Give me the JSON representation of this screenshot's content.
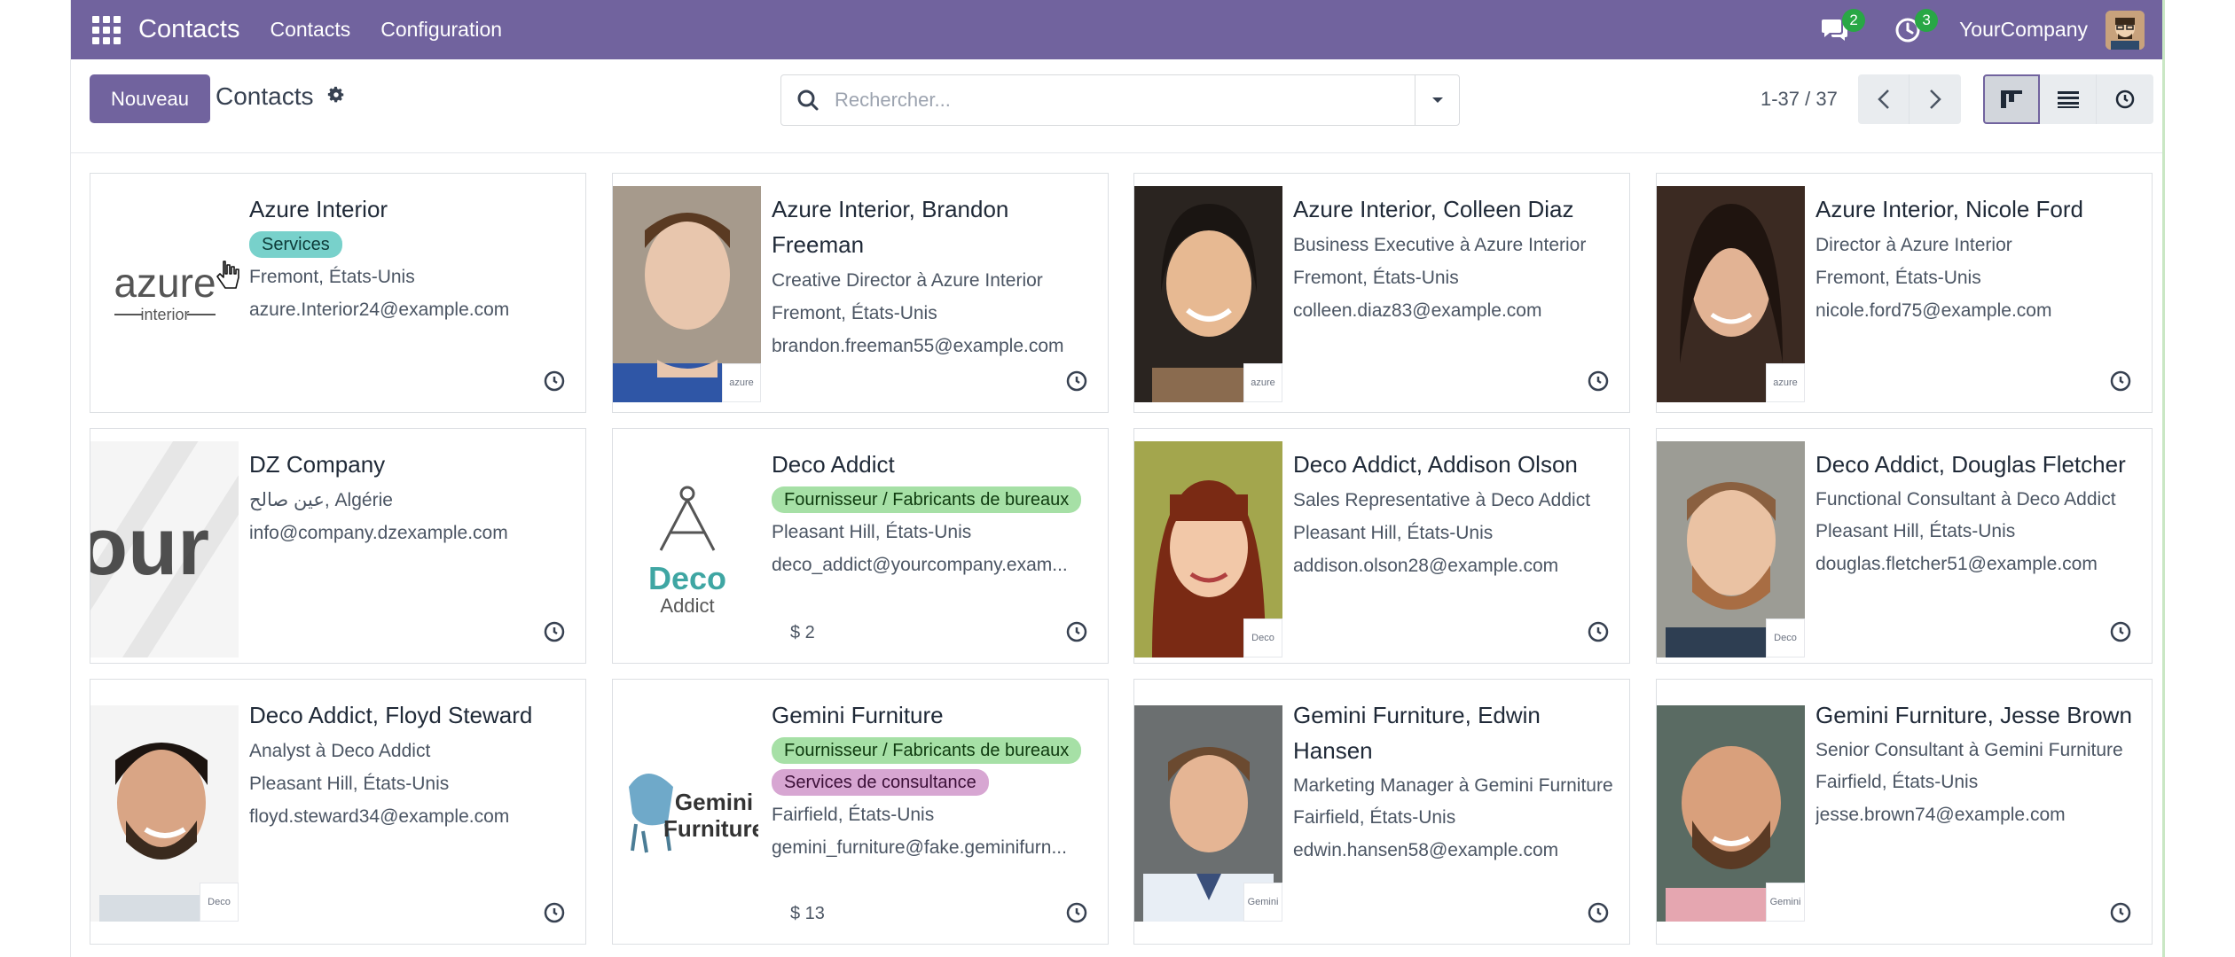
{
  "navbar": {
    "brand": "Contacts",
    "menus": [
      "Contacts",
      "Configuration"
    ],
    "messages_count": "2",
    "activities_count": "3",
    "company": "YourCompany",
    "color": "#71639e"
  },
  "control": {
    "new_label": "Nouveau",
    "breadcrumb": "Contacts",
    "search_placeholder": "Rechercher...",
    "pager": "1-37 / 37",
    "views": [
      "kanban-icon",
      "list-icon",
      "activity-icon"
    ]
  },
  "cards": [
    {
      "name": "Azure Interior",
      "tags": [
        "Services"
      ],
      "lines": [
        "Fremont, États-Unis",
        "azure.Interior24@example.com"
      ],
      "image": "azure-logo"
    },
    {
      "name": "Azure Interior, Brandon Freeman",
      "lines": [
        "Creative Director à Azure Interior",
        "Fremont, États-Unis",
        "brandon.freeman55@example.com"
      ],
      "image": "photo"
    },
    {
      "name": "Azure Interior, Colleen Diaz",
      "lines": [
        "Business Executive à Azure Interior",
        "Fremont, États-Unis",
        "colleen.diaz83@example.com"
      ],
      "image": "photo"
    },
    {
      "name": "Azure Interior, Nicole Ford",
      "lines": [
        "Director à Azure Interior",
        "Fremont, États-Unis",
        "nicole.ford75@example.com"
      ],
      "image": "photo"
    },
    {
      "name": "DZ Company",
      "lines": [
        "عين صالح, Algérie",
        "info@company.dzexample.com"
      ],
      "image": "your-logo"
    },
    {
      "name": "Deco Addict",
      "tags": [
        "Fournisseur / Fabricants de bureaux"
      ],
      "lines": [
        "Pleasant Hill, États-Unis",
        "deco_addict@yourcompany.exam..."
      ],
      "amount": "$ 2",
      "image": "deco-logo"
    },
    {
      "name": "Deco Addict, Addison Olson",
      "lines": [
        "Sales Representative à Deco Addict",
        "Pleasant Hill, États-Unis",
        "addison.olson28@example.com"
      ],
      "image": "photo"
    },
    {
      "name": "Deco Addict, Douglas Fletcher",
      "lines": [
        "Functional Consultant à Deco Addict",
        "Pleasant Hill, États-Unis",
        "douglas.fletcher51@example.com"
      ],
      "image": "photo"
    },
    {
      "name": "Deco Addict, Floyd Steward",
      "lines": [
        "Analyst à Deco Addict",
        "Pleasant Hill, États-Unis",
        "floyd.steward34@example.com"
      ],
      "image": "photo"
    },
    {
      "name": "Gemini Furniture",
      "tags": [
        "Fournisseur / Fabricants de bureaux",
        "Services de consultance"
      ],
      "lines": [
        "Fairfield, États-Unis",
        "gemini_furniture@fake.geminifurn..."
      ],
      "amount": "$ 13",
      "image": "gemini-logo"
    },
    {
      "name": "Gemini Furniture, Edwin Hansen",
      "lines": [
        "Marketing Manager à Gemini Furniture",
        "Fairfield, États-Unis",
        "edwin.hansen58@example.com"
      ],
      "image": "photo"
    },
    {
      "name": "Gemini Furniture, Jesse Brown",
      "lines": [
        "Senior Consultant à Gemini Furniture",
        "Fairfield, États-Unis",
        "jesse.brown74@example.com"
      ],
      "image": "photo"
    }
  ],
  "logos": {
    "azure_main": "azure",
    "azure_sub": "interior",
    "your": "our",
    "deco_main": "Deco",
    "deco_sub": "Addict",
    "gemini_main": "Gemini",
    "gemini_sub": "Furniture"
  }
}
